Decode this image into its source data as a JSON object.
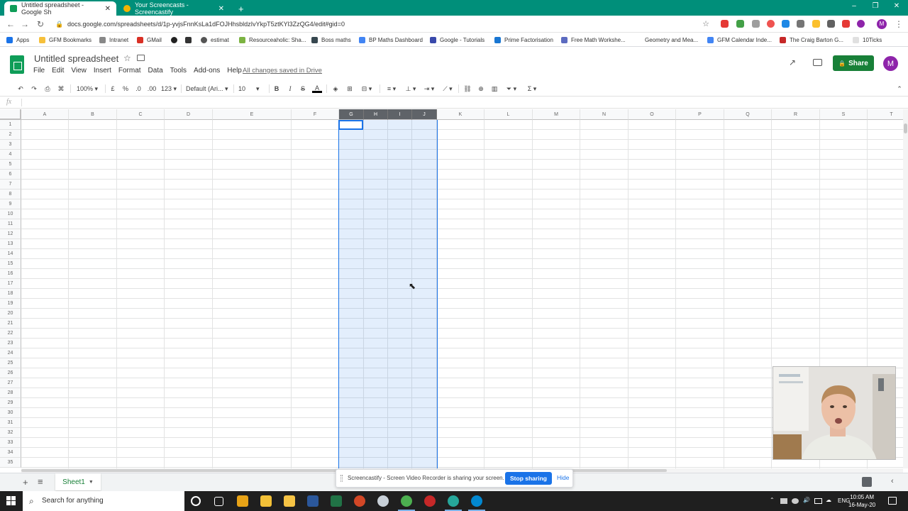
{
  "browser": {
    "tabs": [
      {
        "label": "Untitled spreadsheet - Google Sh",
        "active": true
      },
      {
        "label": "Your Screencasts - Screencastify",
        "active": false
      }
    ],
    "new_tab": "+",
    "url": "docs.google.com/spreadsheets/d/1p-yvjsFnnKsLa1dFOJHhsbldzIvYkpT5ztKYl3ZzQG4/edit#gid=0",
    "window_controls": [
      "–",
      "❐",
      "✕"
    ],
    "accent_color": "#008f7a"
  },
  "bookmarks": [
    {
      "label": "Apps",
      "icon": "apps-grid-icon"
    },
    {
      "label": "GFM Bookmarks",
      "icon": "folder-icon"
    },
    {
      "label": "Intranet",
      "icon": "intranet-icon"
    },
    {
      "label": "GMail",
      "icon": "gmail-icon"
    },
    {
      "label": "",
      "icon": "bookmark-circle-icon"
    },
    {
      "label": "",
      "icon": "bookmark-dots-icon"
    },
    {
      "label": "estimat",
      "icon": "estimat-icon"
    },
    {
      "label": "Resourceaholic: Sha...",
      "icon": "resourceaholic-icon"
    },
    {
      "label": "Boss maths",
      "icon": "boss-maths-icon"
    },
    {
      "label": "BP Maths Dashboard",
      "icon": "docs-icon"
    },
    {
      "label": "Google - Tutorials",
      "icon": "tutorials-icon"
    },
    {
      "label": "Prime Factorisation",
      "icon": "prime-icon"
    },
    {
      "label": "Free Math Workshe...",
      "icon": "worksheet-icon"
    },
    {
      "label": "Geometry and Mea...",
      "icon": "blank-icon"
    },
    {
      "label": "GFM Calendar Inde...",
      "icon": "docs-icon"
    },
    {
      "label": "The Craig Barton G...",
      "icon": "craig-icon"
    },
    {
      "label": "10Ticks",
      "icon": "page-icon"
    }
  ],
  "sheets": {
    "title": "Untitled spreadsheet",
    "menu": [
      "File",
      "Edit",
      "View",
      "Insert",
      "Format",
      "Data",
      "Tools",
      "Add-ons",
      "Help"
    ],
    "saved_status": "All changes saved in Drive",
    "share_label": "Share",
    "avatar_letter": "M",
    "brand_color": "#0f9d58",
    "share_color": "#188038"
  },
  "toolbar": {
    "zoom": "100%",
    "currency": "£",
    "percent": "%",
    "decrease_decimal": ".0",
    "increase_decimal": ".00",
    "more_formats": "123",
    "font": "Default (Ari...",
    "font_size": "10",
    "bold": "B",
    "italic": "I",
    "strike": "S",
    "text_color": "A",
    "sum": "Σ"
  },
  "formula_bar": {
    "label": "fx",
    "value": ""
  },
  "grid": {
    "columns": [
      "A",
      "B",
      "C",
      "D",
      "E",
      "F",
      "G",
      "H",
      "I",
      "J",
      "K",
      "L",
      "M",
      "N",
      "O",
      "P",
      "Q",
      "R",
      "S",
      "T"
    ],
    "selected_columns": [
      "G",
      "H",
      "I",
      "J"
    ],
    "rows": [
      "1",
      "2",
      "3",
      "4",
      "5",
      "6",
      "7",
      "8",
      "9",
      "10",
      "11",
      "12",
      "13",
      "14",
      "15",
      "16",
      "17",
      "18",
      "19",
      "20",
      "21",
      "22",
      "23",
      "24",
      "25",
      "26",
      "27",
      "28",
      "29",
      "30",
      "31",
      "32",
      "33",
      "34",
      "35"
    ],
    "active_cell": "G1",
    "selection_color": "#1a73e8"
  },
  "sheet_tabs": [
    {
      "label": "Sheet1",
      "active": true
    }
  ],
  "screencastify": {
    "message": "Screencastify - Screen Video Recorder is sharing your screen.",
    "stop_label": "Stop sharing",
    "hide_label": "Hide"
  },
  "taskbar": {
    "search_placeholder": "Search for anything",
    "language": "ENG",
    "time": "10:05 AM",
    "date": "16-May-20"
  }
}
